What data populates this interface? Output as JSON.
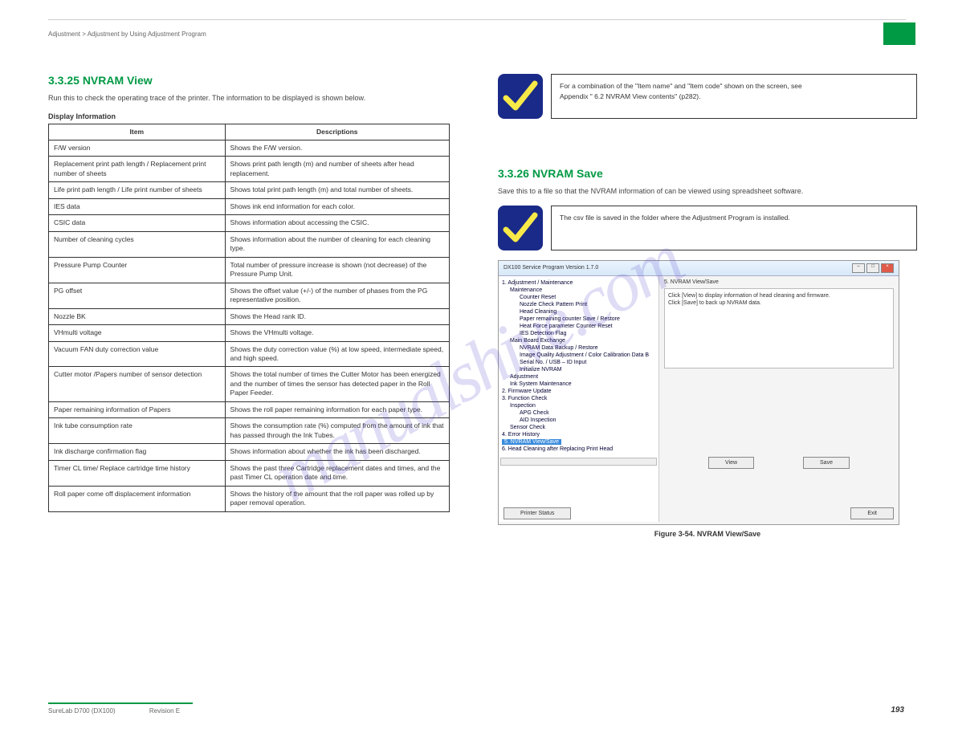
{
  "header": {
    "breadcrumb": "Adjustment > Adjustment by Using Adjustment Program"
  },
  "left": {
    "title": "3.3.25 NVRAM View",
    "intro": "Run this to check the operating trace of the printer. The information to be displayed is shown below.",
    "infoLabel": "Display Information",
    "table": {
      "h0": "Item",
      "h1": "Descriptions",
      "rows": [
        {
          "a": "F/W version",
          "b": "Shows the F/W version."
        },
        {
          "a": "Replacement print path length / Replacement print number of sheets",
          "b": "Shows print path length (m) and number of sheets after head replacement."
        },
        {
          "a": "Life print path length / Life print number of sheets",
          "b": "Shows total print path length (m) and total number of sheets."
        },
        {
          "a": "IES data",
          "b": "Shows ink end information for each color."
        },
        {
          "a": "CSIC data",
          "b": "Shows information about accessing the CSIC."
        },
        {
          "a": "Number of cleaning cycles",
          "b": "Shows information about the number of cleaning for each cleaning type."
        },
        {
          "a": "Pressure Pump Counter",
          "b": "Total number of pressure increase is shown (not decrease) of the Pressure Pump Unit."
        },
        {
          "a": "PG offset",
          "b": "Shows the offset value (+/-) of the number of phases from the PG representative position."
        },
        {
          "a": "Nozzle BK",
          "b": "Shows the Head rank ID."
        },
        {
          "a": "VHmulti voltage",
          "b": "Shows the VHmulti voltage."
        },
        {
          "a": "Vacuum FAN duty correction value",
          "b": "Shows the duty correction value (%) at low speed, intermediate speed, and high speed."
        },
        {
          "a": "Cutter motor /Papers number of sensor detection",
          "b": "Shows the total number of times the Cutter Motor has been energized and the number of times the sensor has detected paper in the Roll Paper Feeder."
        },
        {
          "a": "Paper remaining information of Papers",
          "b": "Shows the roll paper remaining information for each paper type."
        },
        {
          "a": "Ink tube consumption rate",
          "b": "Shows the consumption rate (%) computed from the amount of ink that has passed through the Ink Tubes."
        },
        {
          "a": "Ink discharge confirmation flag",
          "b": "Shows information about whether the ink has been discharged."
        },
        {
          "a": "Timer CL time/ Replace cartridge time history",
          "b": "Shows the past three Cartridge replacement dates and times, and the past Timer CL operation date and time."
        },
        {
          "a": "Roll paper come off displacement information",
          "b": "Shows the history of the amount that the roll paper was rolled up by paper removal operation."
        }
      ]
    }
  },
  "right": {
    "check1_l1": "For a combination of the \"Item name\" and \"Item code\" shown on the screen, see",
    "check1_l2": "Appendix \" 6.2 NVRAM View contents\" (p282).",
    "saveTitle": "3.3.26 NVRAM Save",
    "saveBody": "Save this to a file so that the NVRAM information of can be viewed using spreadsheet software.",
    "check2_l1": "The csv file is saved in the folder where the Adjustment Program is installed.",
    "fig": "Figure 3-54. NVRAM View/Save"
  },
  "ss": {
    "title": "DX100 Service Program  Version 1.7.0",
    "tree": {
      "n1": "1. Adjustment / Maintenance",
      "n1a": "Maintenance",
      "n1a1": "Counter Reset",
      "n1a2": "Nozzle Check Pattern Print",
      "n1a3": "Head Cleaning",
      "n1a4": "Paper remaining counter Save / Restore",
      "n1a5": "Heat Force parameter Counter Reset",
      "n1a6": "IES Detection Flag",
      "n1b": "Main Board Exchange",
      "n1b1": "NVRAM Data Backup / Restore",
      "n1b2": "Image Quality Adjustment / Color Calibration Data B",
      "n1b3": "Serial No. / USB – ID Input",
      "n1b4": "Initialize NVRAM",
      "n1c": "Adjustment",
      "n1d": "Ink System Maintenance",
      "n2": "2. Firmware Update",
      "n3": "3. Function Check",
      "n3a": "Inspection",
      "n3a1": "APG Check",
      "n3a2": "AID Inspection",
      "n3b": "Sensor Check",
      "n4": "4. Error History",
      "n5": "5. NVRAM View/Save",
      "n6": "6. Head Cleaning after Replacing Print Head"
    },
    "rtitle": "5. NVRAM View/Save",
    "msg1": "Click [View] to display information of head cleaning and firmware.",
    "msg2": "Click [Save] to back  up NVRAM data.",
    "view": "View",
    "save": "Save",
    "pstatus": "Printer Status",
    "exit": "Exit"
  },
  "watermark": "manualshive.com",
  "footer": {
    "model": "SureLab D700 (DX100)",
    "rev": "Revision E",
    "page": "193"
  }
}
